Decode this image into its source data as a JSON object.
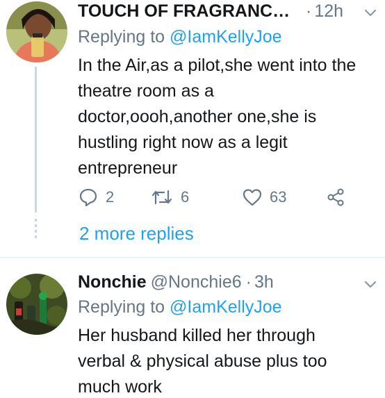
{
  "tweets": [
    {
      "name": "TOUCH OF FRAGRANCE ...",
      "handle": "",
      "dot": "·",
      "time": "12h",
      "replying_prefix": "Replying to",
      "replying_to": "@IamKellyJoe",
      "lines": [
        "In the Air,as a pilot,she went into the",
        "theatre room as a",
        "doctor,oooh,another one,she is",
        "hustling right now as a legit",
        "entrepreneur"
      ],
      "replies": "2",
      "retweets": "6",
      "likes": "63",
      "more_replies": "2 more replies"
    },
    {
      "name": "Nonchie",
      "handle": "@Nonchie6",
      "dot": "·",
      "time": "3h",
      "replying_prefix": "Replying to",
      "replying_to": "@IamKellyJoe",
      "lines": [
        "Her husband killed her through",
        "verbal & physical abuse plus too",
        "much work"
      ]
    }
  ],
  "icons": {
    "reply": "reply-icon",
    "retweet": "retweet-icon",
    "like": "heart-icon",
    "share": "share-icon",
    "menu": "chevron-down-icon"
  },
  "colors": {
    "accent": "#1da1f2",
    "muted": "#657786",
    "text": "#14171a",
    "divider": "#e1e8ed"
  }
}
